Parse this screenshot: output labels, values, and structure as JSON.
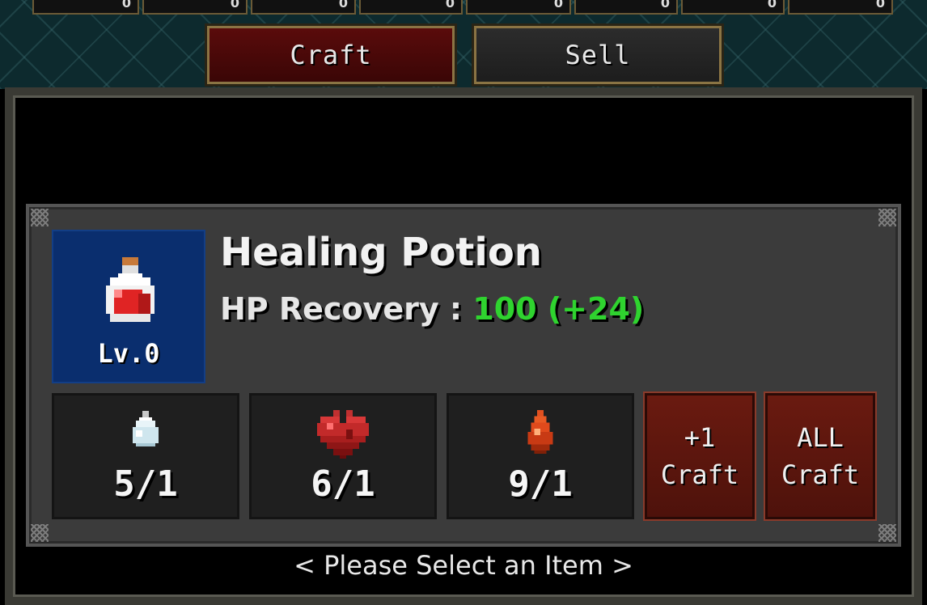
{
  "top_slots": [
    {
      "value": "0"
    },
    {
      "value": "0"
    },
    {
      "value": "0"
    },
    {
      "value": "0"
    },
    {
      "value": "0"
    },
    {
      "value": "0"
    },
    {
      "value": "0"
    },
    {
      "value": "0"
    }
  ],
  "tabs": {
    "craft_label": "Craft",
    "sell_label": "Sell"
  },
  "item": {
    "name": "Healing Potion",
    "level": "Lv.0",
    "stat_label": "HP Recovery : ",
    "stat_value": "100 (+24)",
    "icon": "healing-potion-icon"
  },
  "materials": [
    {
      "icon": "potion-flask-icon",
      "count": "5/1"
    },
    {
      "icon": "heart-icon",
      "count": "6/1"
    },
    {
      "icon": "blood-drop-icon",
      "count": "9/1"
    }
  ],
  "buttons": {
    "plus_one_line1": "+1",
    "plus_one_line2": "Craft",
    "all_line1": "ALL",
    "all_line2": "Craft"
  },
  "hint": "< Please Select an Item >",
  "colors": {
    "stat_value": "#2fd32f",
    "craft_tab": "#5a0b0b",
    "item_bg": "#0a2e6e"
  }
}
